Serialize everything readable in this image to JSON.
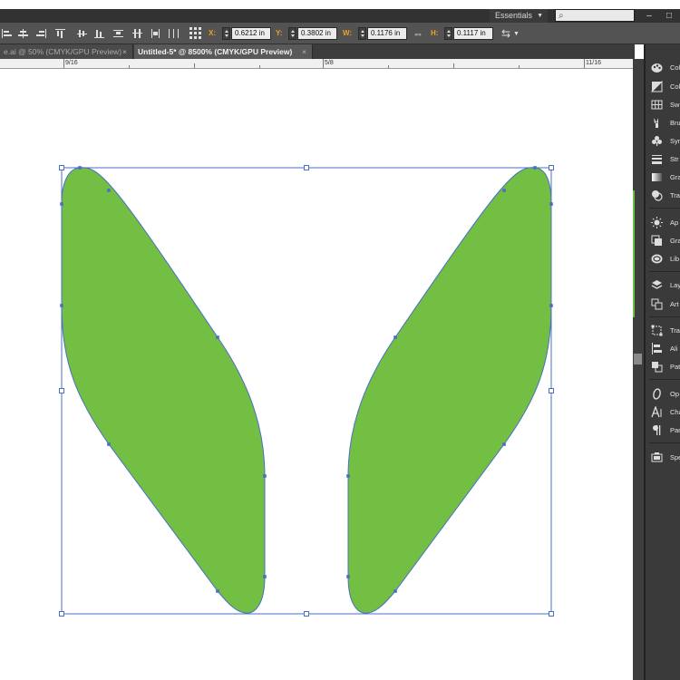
{
  "menubar": {
    "workspace": "Essentials",
    "window_controls": [
      "–",
      "□"
    ]
  },
  "controlbar": {
    "x": {
      "label": "X:",
      "value": "0.6212 in"
    },
    "y": {
      "label": "Y:",
      "value": "0.3802 in"
    },
    "w": {
      "label": "W:",
      "value": "0.1176 in"
    },
    "h": {
      "label": "H:",
      "value": "0.1117 in"
    }
  },
  "tabs": [
    {
      "label": "e.ai @ 50% (CMYK/GPU Preview)",
      "close": "×",
      "active": false
    },
    {
      "label": "Untitled-5* @ 8500% (CMYK/GPU Preview)",
      "close": "×",
      "active": true
    }
  ],
  "ruler": {
    "labels": [
      "9/16",
      "5/8",
      "11/16"
    ]
  },
  "artwork": {
    "fill_color": "#72bf44",
    "selection_color": "#4a6fc4"
  },
  "panels": [
    {
      "label": "Col",
      "icon": "color-icon"
    },
    {
      "label": "Col",
      "icon": "color-guide-icon"
    },
    {
      "label": "Sw",
      "icon": "swatches-icon"
    },
    {
      "label": "Bru",
      "icon": "brushes-icon"
    },
    {
      "label": "Sym",
      "icon": "symbols-icon"
    },
    {
      "label": "Str",
      "icon": "stroke-icon"
    },
    {
      "label": "Gra",
      "icon": "gradient-icon"
    },
    {
      "label": "Tra",
      "icon": "transparency-icon"
    },
    {
      "label": "Ap",
      "icon": "appearance-icon"
    },
    {
      "label": "Gra",
      "icon": "graphic-styles-icon"
    },
    {
      "label": "Lib",
      "icon": "libraries-icon"
    },
    {
      "label": "Lay",
      "icon": "layers-icon"
    },
    {
      "label": "Art",
      "icon": "artboards-icon"
    },
    {
      "label": "Tra",
      "icon": "transform-icon"
    },
    {
      "label": "Ali",
      "icon": "align-icon"
    },
    {
      "label": "Pat",
      "icon": "pathfinder-icon"
    },
    {
      "label": "Op",
      "icon": "opentype-icon"
    },
    {
      "label": "Cha",
      "icon": "character-icon"
    },
    {
      "label": "Par",
      "icon": "paragraph-icon"
    },
    {
      "label": "Spe",
      "icon": "spelling-icon"
    }
  ]
}
